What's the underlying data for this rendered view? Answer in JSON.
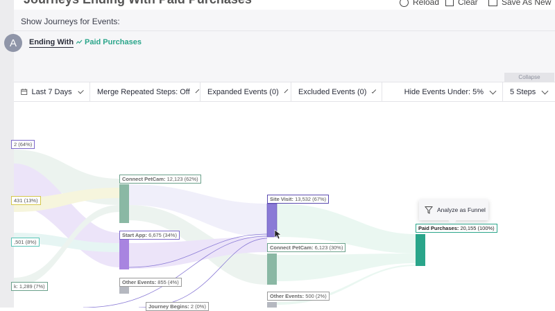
{
  "window": {
    "ghost_title": "Journeys Ending With Paid Purchases",
    "reload": "Reload",
    "clear": "Clear",
    "save_as_new": "Save As New"
  },
  "header": {
    "section_label": "Show Journeys for Events:",
    "avatar_letter": "A",
    "ending_with": "Ending With",
    "event_name": "Paid Purchases",
    "collapse": "Collapse"
  },
  "toolbar": {
    "date_range": "Last 7 Days",
    "merge_steps": "Merge Repeated Steps: Off",
    "expanded_events": "Expanded Events (0)",
    "excluded_events": "Excluded Events (0)",
    "hide_events": "Hide Events Under: 5%",
    "steps": "5 Steps"
  },
  "nodes": {
    "left1": "2 (64%)",
    "left2": "431 (13%)",
    "left3": ",501 (8%)",
    "left4": "k: 1,289 (7%)",
    "connect_petcam_2": {
      "name": "Connect PetCam:",
      "value": "12,123 (62%)"
    },
    "start_app": {
      "name": "Start App:",
      "value": "6,675 (34%)"
    },
    "other_events_2": {
      "name": "Other Events:",
      "value": "855 (4%)"
    },
    "journey_begins": {
      "name": "Journey Begins:",
      "value": "2 (0%)"
    },
    "site_visit": {
      "name": "Site Visit:",
      "value": "13,532 (67%)"
    },
    "connect_petcam_3": {
      "name": "Connect PetCam:",
      "value": "6,123 (30%)"
    },
    "other_events_3": {
      "name": "Other Events:",
      "value": "500 (2%)"
    },
    "paid_purchases": {
      "name": "Paid Purchases:",
      "value": "20,155 (100%)"
    }
  },
  "tooltip": {
    "label": "Analyze as Funnel"
  },
  "colors": {
    "accent": "#2aa58a",
    "purple": "#a884e0",
    "sage": "#8ab8a4",
    "gray": "#b5b8c0"
  }
}
